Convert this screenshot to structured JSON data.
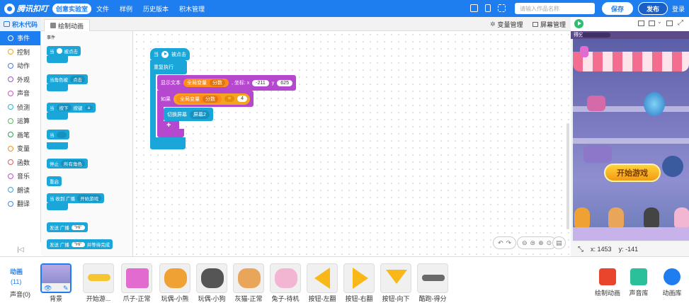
{
  "topbar": {
    "logo_text": "腾讯扣叮",
    "logo_badge": "创意实验室",
    "menu": [
      "文件",
      "样例",
      "历史版本",
      "积木管理"
    ],
    "search_placeholder": "请输入作品名称",
    "save": "保存",
    "publish": "发布",
    "login": "登录"
  },
  "toolbar2": {
    "code_tab": "积木代码",
    "draw_tab": "绘制动画",
    "var_manage": "变量管理",
    "screen_manage": "屏幕管理"
  },
  "categories": [
    {
      "label": "事件",
      "color": "#1aa6d9",
      "active": true
    },
    {
      "label": "控制",
      "color": "#f4a520"
    },
    {
      "label": "动作",
      "color": "#4a7bf0"
    },
    {
      "label": "外观",
      "color": "#9b59d0"
    },
    {
      "label": "声音",
      "color": "#d64fc0"
    },
    {
      "label": "侦测",
      "color": "#26b8c8"
    },
    {
      "label": "运算",
      "color": "#5cb85c"
    },
    {
      "label": "画笔",
      "color": "#2e9e58"
    },
    {
      "label": "变量",
      "color": "#ff8c1a"
    },
    {
      "label": "函数",
      "color": "#e65c5c"
    },
    {
      "label": "音乐",
      "color": "#c04fd0"
    },
    {
      "label": "朗读",
      "color": "#3aa0e0"
    },
    {
      "label": "翻译",
      "color": "#4b86e8"
    }
  ],
  "palette": {
    "section": "事件",
    "b1": {
      "when": "当",
      "clicked": "被点击"
    },
    "b2": {
      "text": "当角色被",
      "dd": "点击"
    },
    "b3": {
      "when": "当",
      "dd1": "按下",
      "key": "按键",
      "dd2": "a"
    },
    "b4": {
      "when": "当"
    },
    "b5": {
      "text": "停止",
      "dd": "所有角色"
    },
    "b6": {
      "text": "重启"
    },
    "b7": {
      "text": "当 收到 广播",
      "dd": "开始游戏"
    },
    "b8": {
      "text": "发送 广播",
      "val": "\"Hi\""
    },
    "b9": {
      "text": "发送 广播",
      "val": "\"Hi\"",
      "tail": "并等待完成"
    }
  },
  "script": {
    "hat_when": "当",
    "hat_clicked": "被点击",
    "repeat": "重复执行",
    "show_text": "显示文本",
    "global_var": "全局变量",
    "var_name": "分数",
    "coord": ", 坐标: x",
    "x": "-211",
    "y_label": "y",
    "y": "625",
    "if": "如果",
    "op": "=",
    "cmp": "4",
    "switch_screen": "切换屏幕",
    "screen_name": "屏幕2"
  },
  "stage": {
    "header": "得分",
    "start_button": "开始游戏",
    "x_label": "x:",
    "x": "1453",
    "y_label": "y:",
    "y": "-141"
  },
  "bottom": {
    "anim_label": "动画",
    "anim_count": "(11)",
    "sound_label": "声音(0)",
    "sprites": [
      {
        "label": "背景",
        "color": "#b9a7e6"
      },
      {
        "label": "开始游...",
        "color": "#f6c531"
      },
      {
        "label": "爪子-正常",
        "color": "#e26bd0"
      },
      {
        "label": "玩偶-小熊",
        "color": "#f0a134"
      },
      {
        "label": "玩偶-小狗",
        "color": "#555555"
      },
      {
        "label": "灰猫-正常",
        "color": "#e9a65a"
      },
      {
        "label": "兔子-待机",
        "color": "#f3b6d2"
      },
      {
        "label": "按钮-左翻",
        "color": "#f9b818"
      },
      {
        "label": "按钮-右翻",
        "color": "#f9b818"
      },
      {
        "label": "按钮-向下",
        "color": "#f9b818"
      },
      {
        "label": "酷跑-得分",
        "color": "#6a6a6a"
      }
    ],
    "tools": [
      {
        "label": "绘制动画",
        "color": "#e8452c"
      },
      {
        "label": "声音库",
        "color": "#2cc09a"
      },
      {
        "label": "动画库",
        "color": "#1e7ef0"
      }
    ]
  },
  "colors": {
    "brand": "#1e7ef0",
    "event": "#1aa6d9",
    "control": "#f4a520",
    "looks": "#9b59d0",
    "variable": "#ff8c1a",
    "operator": "#5cb85c"
  }
}
